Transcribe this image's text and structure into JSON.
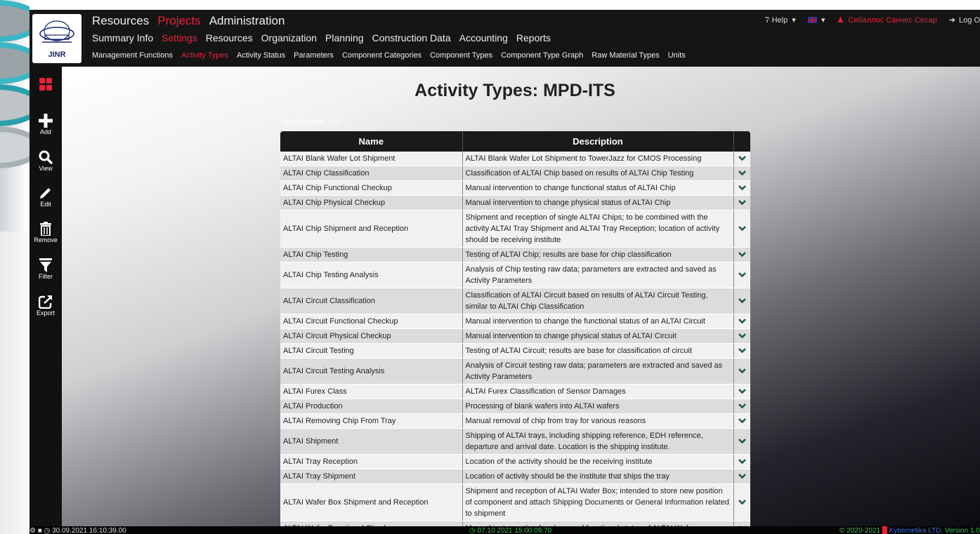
{
  "header": {
    "logo_text": "JINR",
    "nav_primary": [
      {
        "label": "Resources",
        "active": false
      },
      {
        "label": "Projects",
        "active": true
      },
      {
        "label": "Administration",
        "active": false
      }
    ],
    "nav_secondary": [
      {
        "label": "Summary Info",
        "active": false
      },
      {
        "label": "Settings",
        "active": true
      },
      {
        "label": "Resources",
        "active": false
      },
      {
        "label": "Organization",
        "active": false
      },
      {
        "label": "Planning",
        "active": false
      },
      {
        "label": "Construction Data",
        "active": false
      },
      {
        "label": "Accounting",
        "active": false
      },
      {
        "label": "Reports",
        "active": false
      }
    ],
    "nav_tertiary": [
      {
        "label": "Management Functions",
        "active": false
      },
      {
        "label": "Activity Types",
        "active": true
      },
      {
        "label": "Activity Status",
        "active": false
      },
      {
        "label": "Parameters",
        "active": false
      },
      {
        "label": "Component Categories",
        "active": false
      },
      {
        "label": "Component Types",
        "active": false
      },
      {
        "label": "Component Type Graph",
        "active": false
      },
      {
        "label": "Raw Material Types",
        "active": false
      },
      {
        "label": "Units",
        "active": false
      }
    ],
    "help_label": "Help",
    "user_name": "Себаллос Санчес Сесар",
    "logout_label": "Log O"
  },
  "sidebar": {
    "items": [
      {
        "name": "add",
        "label": "Add",
        "icon": "plus-icon"
      },
      {
        "name": "view",
        "label": "View",
        "icon": "search-icon"
      },
      {
        "name": "edit",
        "label": "Edit",
        "icon": "pencil-icon"
      },
      {
        "name": "remove",
        "label": "Remove",
        "icon": "trash-icon"
      },
      {
        "name": "filter",
        "label": "Filter",
        "icon": "filter-icon"
      },
      {
        "name": "export",
        "label": "Export",
        "icon": "export-icon"
      }
    ]
  },
  "main": {
    "title": "Activity Types: MPD-ITS",
    "total_records": "Total Records: 127",
    "columns": [
      "Name",
      "Description"
    ],
    "rows": [
      {
        "name": "ALTAI Blank Wafer Lot Shipment",
        "description": "ALTAI Blank Wafer Lot Shipment to TowerJazz for CMOS Processing"
      },
      {
        "name": "ALTAI Chip Classification",
        "description": "Classification of ALTAI Chip based on results of ALTAI Chip Testing"
      },
      {
        "name": "ALTAI Chip Functional Checkup",
        "description": "Manual intervention to change functional status of ALTAI Chip"
      },
      {
        "name": "ALTAI Chip Physical Checkup",
        "description": "Manual intervention to change physical status of ALTAI Chip"
      },
      {
        "name": "ALTAI Chip Shipment and Reception",
        "description": "Shipment and reception of single ALTAI Chips; to be combined with the activity ALTAI Tray Shipment and ALTAI Tray Reception; location of activity should be receiving institute"
      },
      {
        "name": "ALTAI Chip Testing",
        "description": "Testing of ALTAI Chip; results are base for chip classification"
      },
      {
        "name": "ALTAI Chip Testing Analysis",
        "description": "Analysis of Chip testing raw data; parameters are extracted and saved as Activity Parameters"
      },
      {
        "name": "ALTAI Circuit Classification",
        "description": "Classification of ALTAI Circuit based on results of ALTAI Circuit Testing, similar to ALTAI Chip Classification"
      },
      {
        "name": "ALTAI Circuit Functional Checkup",
        "description": "Manual intervention to change the functional status of an ALTAI Circuit"
      },
      {
        "name": "ALTAI Circuit Physical Checkup",
        "description": "Manual intervention to change physical status of ALTAI Circuit"
      },
      {
        "name": "ALTAI Circuit Testing",
        "description": "Testing of ALTAI Circuit; results are base for classification of circuit"
      },
      {
        "name": "ALTAI Circuit Testing Analysis",
        "description": "Analysis of Circuit testing raw data; parameters are extracted and saved as Activity Parameters"
      },
      {
        "name": "ALTAI Furex Class",
        "description": "ALTAI Furex Classification of Sensor Damages"
      },
      {
        "name": "ALTAI Production",
        "description": "Processing of blank wafers into ALTAI wafers"
      },
      {
        "name": "ALTAI Removing Chip From Tray",
        "description": "Manual removal of chip from tray for various reasons"
      },
      {
        "name": "ALTAI Shipment",
        "description": "Shipping of ALTAI trays, including shipping reference, EDH reference, departure and arrival date. Location is the shipping institute."
      },
      {
        "name": "ALTAI Tray Reception",
        "description": "Location of the activity should be the receiving institute"
      },
      {
        "name": "ALTAI Tray Shipment",
        "description": "Location of activity should be the institute that ships the tray"
      },
      {
        "name": "ALTAI Wafer Box Shipment and Reception",
        "description": "Shipment and reception of ALTAI Wafer Box; intended to store new position of component and attach Shipping Documents or General Information related to shipment"
      },
      {
        "name": "ALTAI Wafer Functional Checkup",
        "description": "Manual invtervention for change of functional status of ALTAI Wafer"
      }
    ]
  },
  "footer": {
    "login_time": "30.09.2021 16:10:39.00",
    "server_time": "07.10.2021 15:00:09.70",
    "copyright": "© 2020-2021",
    "company": "Kybernetika LTD.",
    "version": "Version 1.0"
  },
  "colors": {
    "accent": "#e8223a",
    "header_bg": "#151515",
    "chevron": "#1e5e3a",
    "footer_green": "#3fbf55"
  }
}
